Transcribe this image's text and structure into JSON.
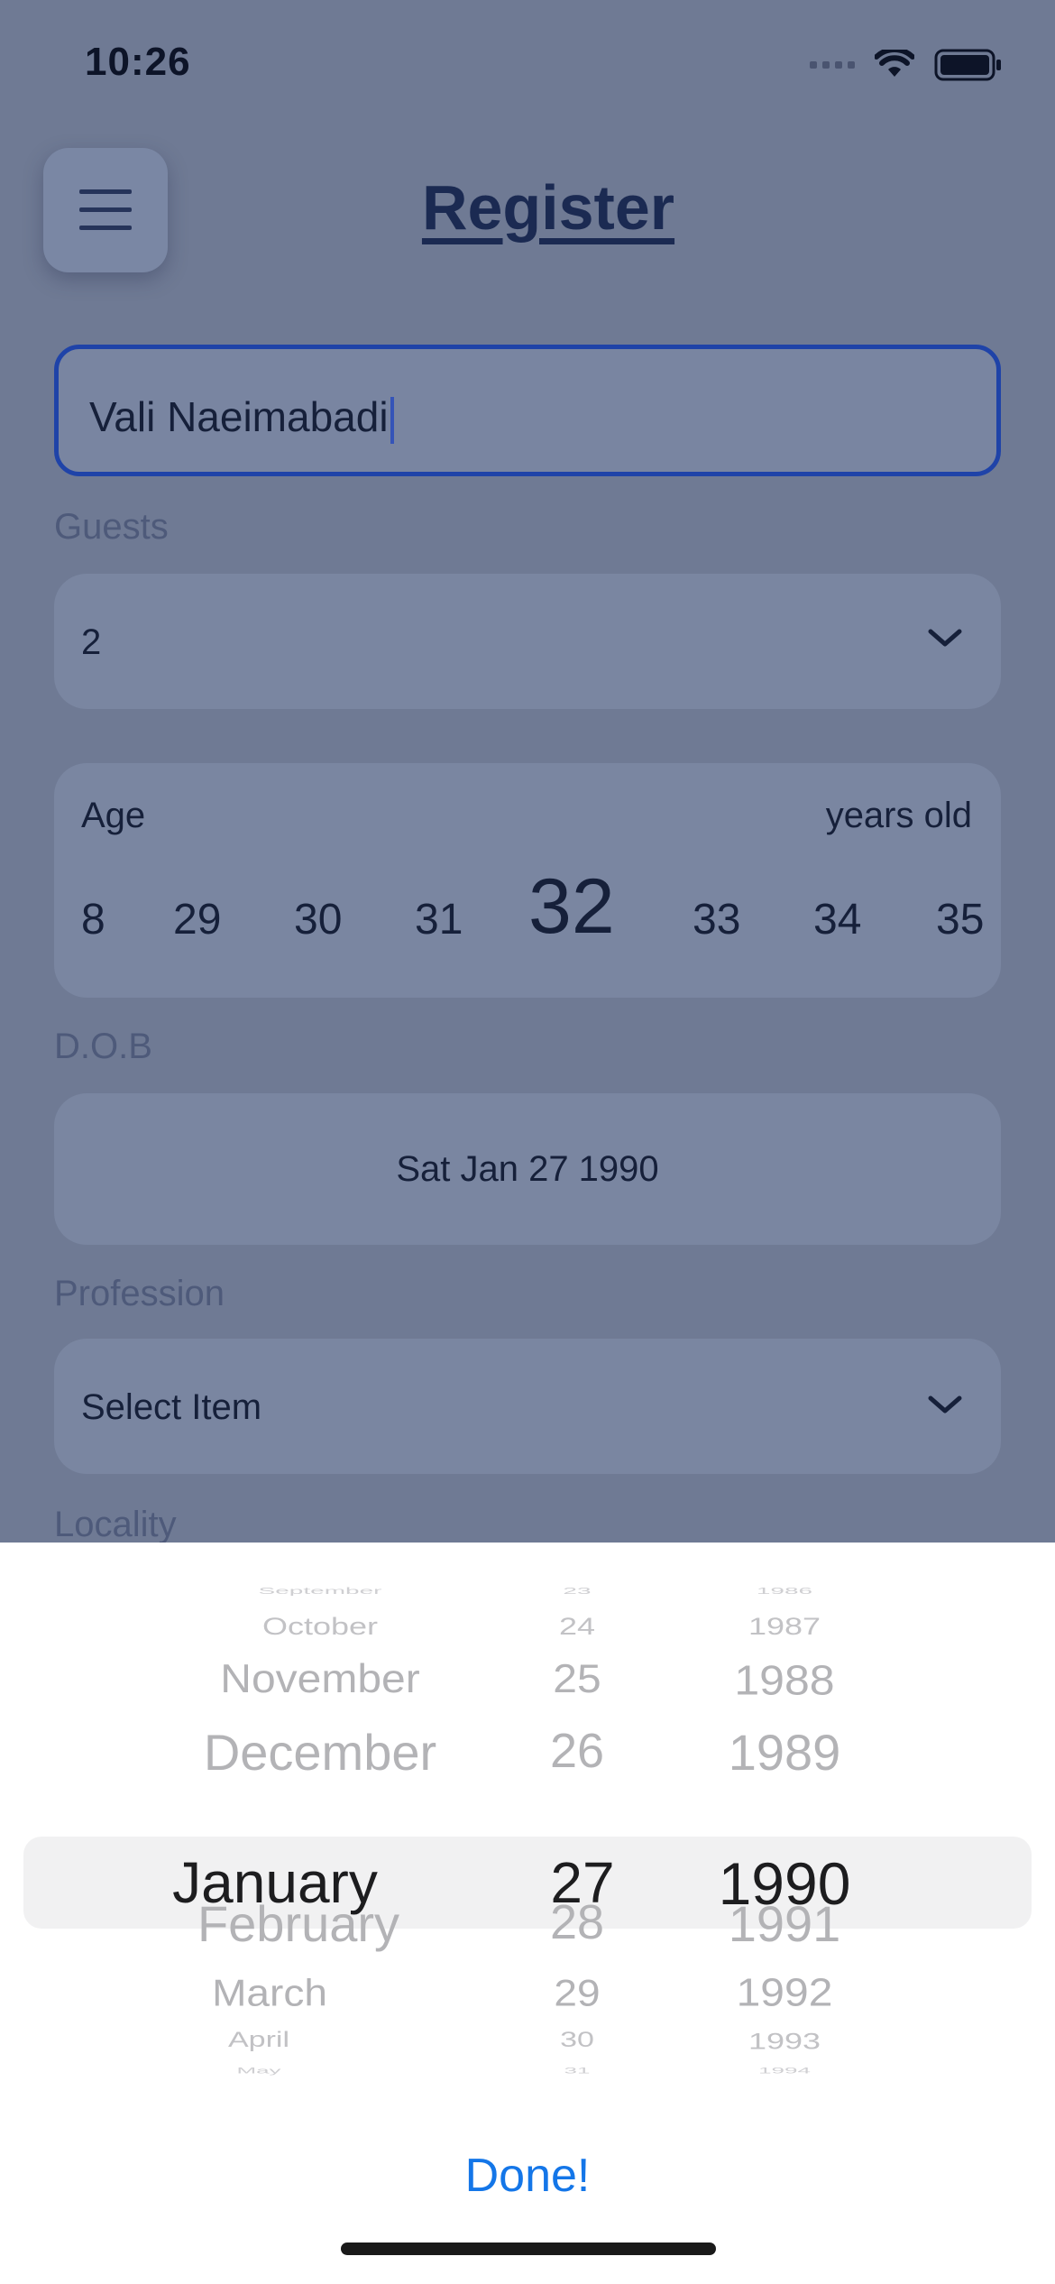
{
  "status_bar": {
    "time": "10:26"
  },
  "header": {
    "title": "Register"
  },
  "name_field": {
    "value": "Vali Naeimabadi"
  },
  "guests": {
    "label": "Guests",
    "value": "2"
  },
  "age": {
    "label": "Age",
    "unit": "years old",
    "values": [
      "8",
      "29",
      "30",
      "31",
      "32",
      "33",
      "34",
      "35"
    ],
    "selected": "32"
  },
  "dob": {
    "label": "D.O.B",
    "value": "Sat Jan 27 1990"
  },
  "profession": {
    "label": "Profession",
    "value": "Select Item"
  },
  "locality": {
    "label": "Locality"
  },
  "date_picker": {
    "months": [
      "September",
      "October",
      "November",
      "December",
      "January",
      "February",
      "March",
      "April",
      "May"
    ],
    "days": [
      "23",
      "24",
      "25",
      "26",
      "27",
      "28",
      "29",
      "30",
      "31"
    ],
    "years": [
      "1986",
      "1987",
      "1988",
      "1989",
      "1990",
      "1991",
      "1992",
      "1993",
      "1994"
    ],
    "selected": {
      "month": "January",
      "day": "27",
      "year": "1990"
    }
  },
  "done_button": {
    "label": "Done!"
  },
  "colors": {
    "accent": "#1476e8",
    "input_border": "#1f43a8",
    "overlay": "#6f7a94"
  }
}
